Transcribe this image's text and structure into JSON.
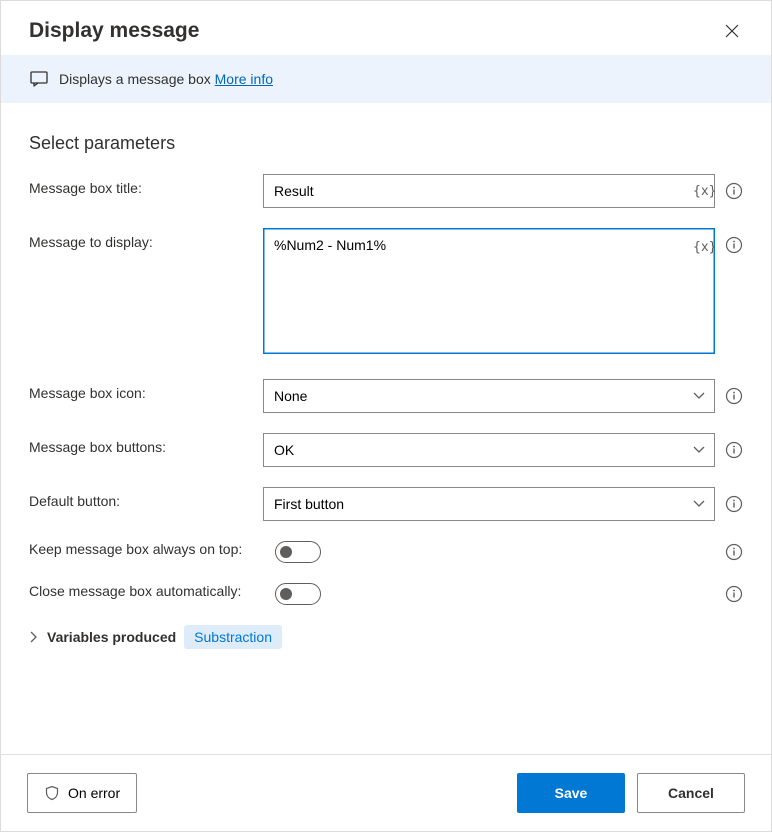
{
  "header": {
    "title": "Display message"
  },
  "infoBar": {
    "text": "Displays a message box",
    "moreInfo": "More info"
  },
  "section": {
    "title": "Select parameters"
  },
  "params": {
    "titleLabel": "Message box title:",
    "titleValue": "Result",
    "messageLabel": "Message to display:",
    "messageValue": "%Num2 - Num1%",
    "iconLabel": "Message box icon:",
    "iconValue": "None",
    "buttonsLabel": "Message box buttons:",
    "buttonsValue": "OK",
    "defaultLabel": "Default button:",
    "defaultValue": "First button",
    "keepOnTopLabel": "Keep message box always on top:",
    "closeAutoLabel": "Close message box automatically:"
  },
  "varToken": "{x}",
  "variables": {
    "label": "Variables produced",
    "pill": "Substraction"
  },
  "footer": {
    "onError": "On error",
    "save": "Save",
    "cancel": "Cancel"
  }
}
